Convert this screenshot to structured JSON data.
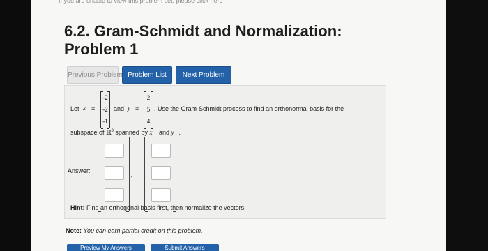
{
  "banner": {
    "text": "If you are unable to view this problem set, please click here"
  },
  "page": {
    "title_line1": "6.2. Gram-Schmidt and Normalization:",
    "title_line2": "Problem 1"
  },
  "nav": {
    "prev_label": "Previous Problem",
    "list_label": "Problem List",
    "next_label": "Next Problem"
  },
  "problem": {
    "let_label": "Let",
    "x_symbol": "x⃗",
    "equals": "=",
    "x_vector": [
      "-2",
      "-2",
      "-1"
    ],
    "and_label": "and",
    "y_symbol": "y⃗",
    "y_vector": [
      "2",
      "5",
      "4"
    ],
    "instruction": ". Use the Gram-Schmidt process to find an orthonormal basis for the",
    "subspace_label": "subspace of",
    "space_symbol": "ℝ",
    "space_exponent": "3",
    "spanned_by": "spanned by",
    "x_again": "x⃗",
    "and2": "and",
    "y_again": "y⃗",
    "period": "."
  },
  "answer": {
    "label": "Answer:",
    "separator": ",",
    "vector1": [
      "",
      "",
      ""
    ],
    "vector2": [
      "",
      "",
      ""
    ]
  },
  "hint": {
    "bold": "Hint:",
    "text": "Find an orthogonal basis first, then normalize the vectors."
  },
  "note": {
    "bold": "Note:",
    "text": "You can earn partial credit on this problem."
  },
  "footer": {
    "preview_label": "Preview My Answers",
    "submit_label": "Submit Answers"
  }
}
